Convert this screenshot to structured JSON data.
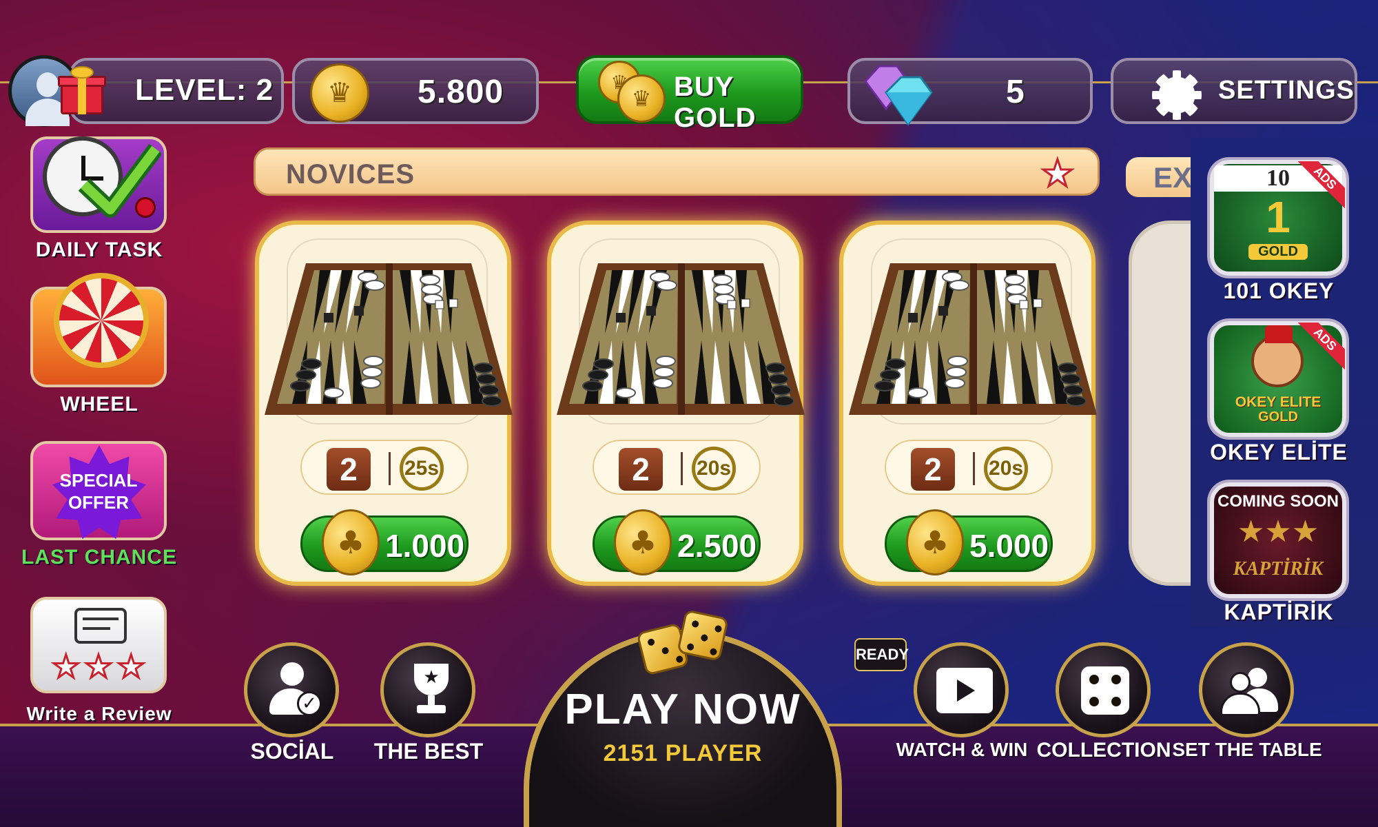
{
  "topbar": {
    "level_label": "LEVEL: 2",
    "gold_amount": "5.800",
    "buy_gold_label": "BUY GOLD",
    "gems_amount": "5",
    "settings_label": "SETTINGS"
  },
  "left_menu": {
    "daily_task": "DAILY TASK",
    "wheel": "WHEEL",
    "special_offer_line1": "SPECIAL",
    "special_offer_line2": "OFFER",
    "last_chance": "LAST CHANCE",
    "write_review": "Write a Review"
  },
  "rooms": {
    "header_title": "NOVICES",
    "next_header_peek": "EXI",
    "cards": [
      {
        "players": "2",
        "timer": "25s",
        "bet": "1.000"
      },
      {
        "players": "2",
        "timer": "20s",
        "bet": "2.500"
      },
      {
        "players": "2",
        "timer": "20s",
        "bet": "5.000"
      }
    ]
  },
  "right_menu": {
    "items": [
      {
        "label": "101 OKEY",
        "badge": "ADS",
        "tile_text_top": "10",
        "tile_text_mid": "1",
        "tile_text_bottom": "GOLD"
      },
      {
        "label": "OKEY ELİTE",
        "badge": "ADS",
        "tile_text_top": "OKEY ELITE",
        "tile_text_bottom": "GOLD"
      },
      {
        "label": "KAPTİRİK",
        "tile_text_top": "COMING SOON",
        "tile_text_bottom": "KAPTİRİK"
      }
    ]
  },
  "bottom_nav": {
    "social": "SOCİAL",
    "the_best": "THE BEST",
    "play_now": "PLAY NOW",
    "player_count": "2151 PLAYER",
    "ready": "READY",
    "watch_win": "WATCH & WIN",
    "collection": "COLLECTION",
    "set_table": "SET THE TABLE"
  },
  "colors": {
    "gold_accent": "#c8a24a",
    "green_button": "#1e9a1e",
    "card_bg": "#fbf2dc",
    "header_bg": "#f4c68a"
  }
}
